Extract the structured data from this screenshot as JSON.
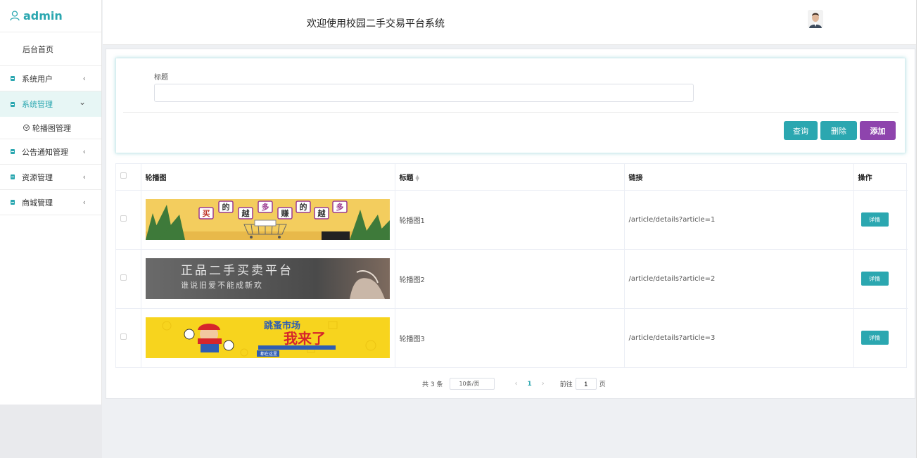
{
  "sidebar": {
    "user": "admin",
    "home": "后台首页",
    "items": [
      {
        "label": "系统用户",
        "arrow": "‹"
      },
      {
        "label": "系统管理",
        "arrow": "⌄"
      },
      {
        "label": "公告通知管理",
        "arrow": "‹"
      },
      {
        "label": "资源管理",
        "arrow": "‹"
      },
      {
        "label": "商城管理",
        "arrow": "‹"
      }
    ],
    "subitem": "轮播图管理"
  },
  "header": {
    "title": "欢迎使用校园二手交易平台系统"
  },
  "search": {
    "label": "标题",
    "value": "",
    "query_label": "查询",
    "delete_label": "删除",
    "add_label": "添加"
  },
  "table": {
    "columns": [
      "轮播图",
      "标题",
      "链接",
      "操作"
    ],
    "rows": [
      {
        "title": "轮播图1",
        "link": "/article/details?article=1",
        "action": "详情"
      },
      {
        "title": "轮播图2",
        "link": "/article/details?article=2",
        "action": "详情"
      },
      {
        "title": "轮播图3",
        "link": "/article/details?article=3",
        "action": "详情"
      }
    ]
  },
  "banners": {
    "b1_text": [
      "买",
      "的",
      "越",
      "多",
      "赚",
      "的",
      "越",
      "多"
    ],
    "b2_main": "正品二手买卖平台",
    "b2_sub": "谁说旧爱不能成新欢",
    "b3_main": "跳蚤市场",
    "b3_big": "我来了",
    "b3_small": "都在这里"
  },
  "pagination": {
    "total": "共 3 条",
    "page_size": "10条/页",
    "current": "1",
    "goto": "前往",
    "goto_value": "1",
    "page_unit": "页"
  },
  "colors": {
    "accent": "#2ba7b0",
    "add_button": "#8e44ad"
  }
}
